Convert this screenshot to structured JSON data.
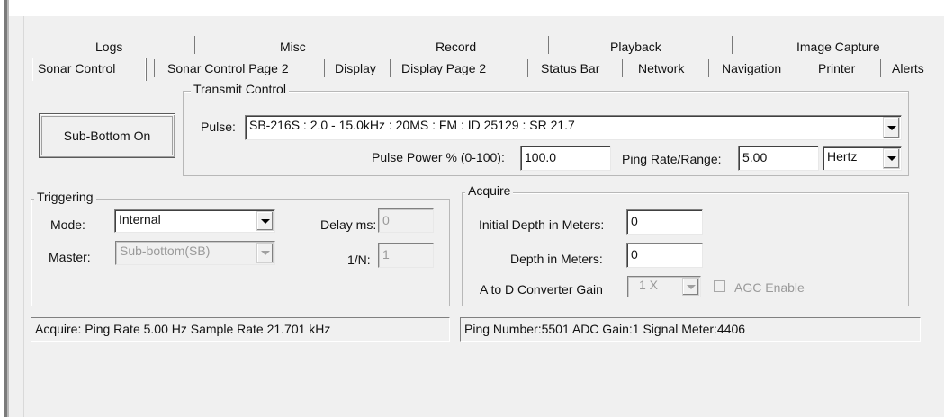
{
  "tabs": {
    "row_back": [
      "Logs",
      "Misc",
      "Record",
      "Playback",
      "Image Capture"
    ],
    "row_front": [
      "Sonar Control",
      "Sonar Control Page 2",
      "Display",
      "Display Page 2",
      "Status Bar",
      "Network",
      "Navigation",
      "Printer",
      "Alerts"
    ],
    "active": "Sonar Control"
  },
  "sub_bottom_button": "Sub-Bottom On",
  "transmit": {
    "title": "Transmit Control",
    "pulse_label": "Pulse:",
    "pulse_value": "SB-216S :  2.0 - 15.0kHz : 20MS : FM : ID 25129 : SR 21.7",
    "power_label": "Pulse Power % (0-100):",
    "power_value": "100.0",
    "ping_rate_label": "Ping Rate/Range:",
    "ping_rate_value": "5.00",
    "ping_rate_unit": "Hertz"
  },
  "triggering": {
    "title": "Triggering",
    "mode_label": "Mode:",
    "mode_value": "Internal",
    "master_label": "Master:",
    "master_value": "Sub-bottom(SB)",
    "delay_label": "Delay ms:",
    "delay_value": "0",
    "n_label": "1/N:",
    "n_value": "1"
  },
  "acquire": {
    "title": "Acquire",
    "initial_depth_label": "Initial Depth in Meters:",
    "initial_depth_value": "0",
    "depth_label": "Depth in Meters:",
    "depth_value": "0",
    "adc_gain_label": "A to D Converter Gain",
    "adc_gain_value": "1 X",
    "agc_label": "AGC Enable"
  },
  "status_left": "Acquire:  Ping Rate     5.00 Hz  Sample Rate  21.701 kHz",
  "status_right": "Ping Number:5501   ADC Gain:1   Signal Meter:4406",
  "colors": {
    "panel": "#f0f0f0",
    "disabled_text": "#9a9a9a",
    "border_dark": "#808080"
  }
}
